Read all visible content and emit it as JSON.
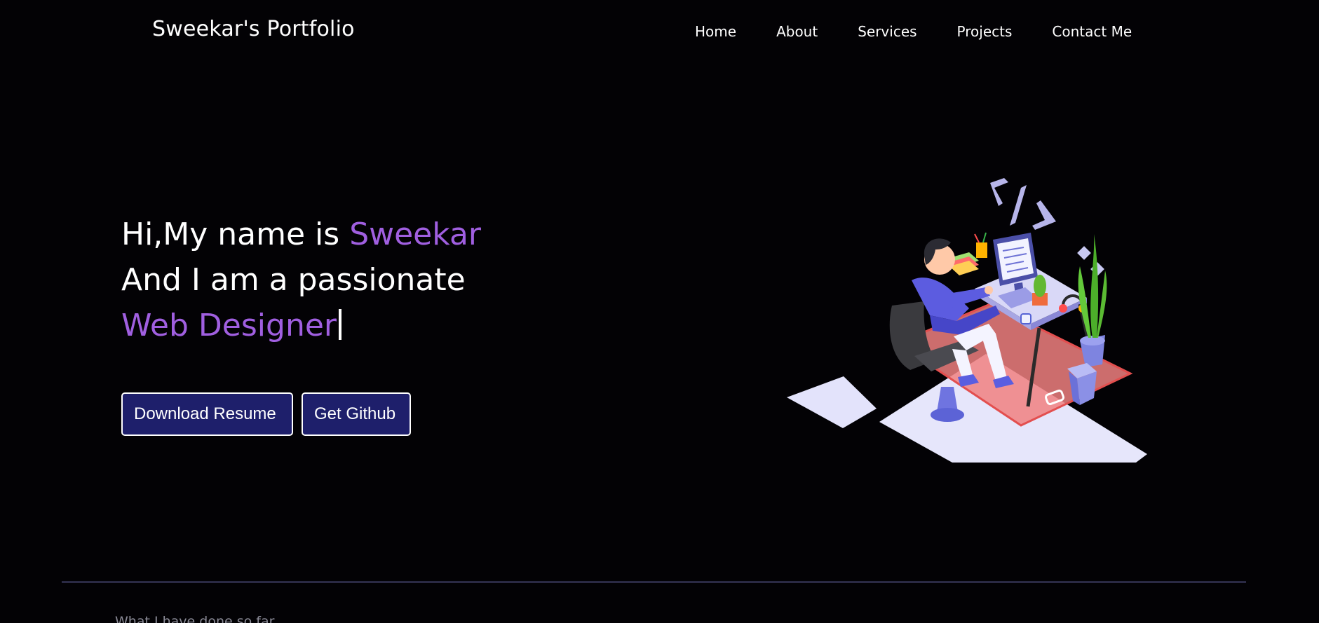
{
  "brand": {
    "title": "Sweekar's Portfolio"
  },
  "nav": {
    "items": [
      {
        "label": "Home"
      },
      {
        "label": "About"
      },
      {
        "label": "Services"
      },
      {
        "label": "Projects"
      },
      {
        "label": "Contact Me"
      }
    ]
  },
  "hero": {
    "line1_prefix": "Hi,My name is ",
    "line1_name": "Sweekar",
    "line2": "And I am a passionate",
    "line3_role": "Web Designer",
    "buttons": {
      "download_resume": "Download Resume",
      "github": "Get Github"
    },
    "illustration_icon": "developer-at-desk-illustration"
  },
  "section": {
    "subtitle": "What I have done so far"
  },
  "colors": {
    "background": "#030205",
    "accent": "#a05fe0",
    "button_bg": "#1e1f6b",
    "divider": "#8c8ce0"
  }
}
